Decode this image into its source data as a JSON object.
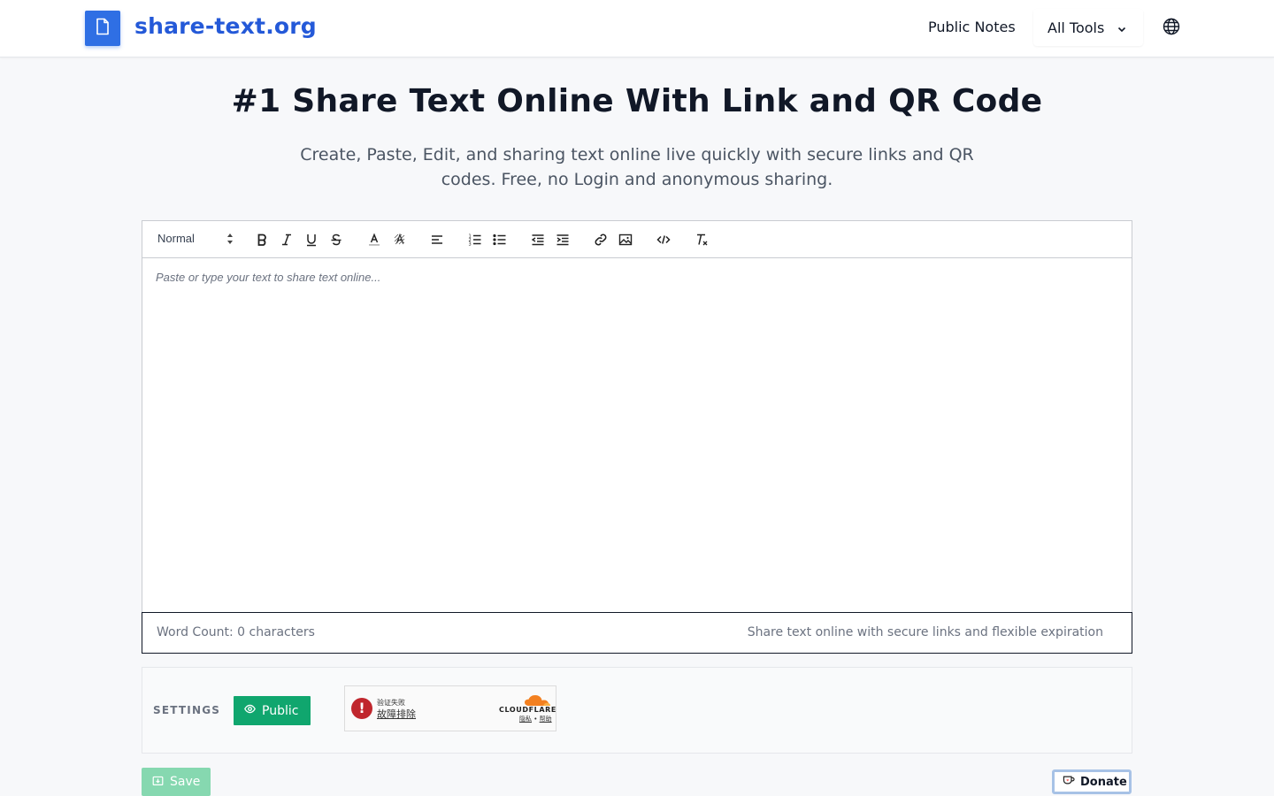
{
  "header": {
    "brand": "share-text.org",
    "nav_public_notes": "Public Notes",
    "nav_all_tools": "All Tools",
    "logo_icon": "document-icon",
    "language_icon": "globe-icon"
  },
  "hero": {
    "title": "#1 Share Text Online With Link and QR Code",
    "subtitle": "Create, Paste, Edit, and sharing text online live quickly with secure links and QR codes. Free, no Login and anonymous sharing."
  },
  "editor": {
    "format_selected": "Normal",
    "toolbar_icons": [
      "bold-icon",
      "italic-icon",
      "underline-icon",
      "strike-icon",
      "text-color-icon",
      "background-color-icon",
      "align-icon",
      "ordered-list-icon",
      "bullet-list-icon",
      "outdent-icon",
      "indent-icon",
      "link-icon",
      "image-icon",
      "code-icon",
      "clear-format-icon"
    ],
    "placeholder": "Paste or type your text to share text online...",
    "word_count": "Word Count: 0 characters",
    "footer_note": "Share text online with secure links and flexible expiration"
  },
  "settings": {
    "label": "SETTINGS",
    "visibility_button": "Public",
    "captcha": {
      "status_line": "验证失败",
      "troubleshoot_link": "故障排除",
      "provider": "CLOUDFLARE",
      "privacy_link": "隐私",
      "separator": "•",
      "help_link": "帮助"
    }
  },
  "actions": {
    "save_label": "Save",
    "donate_label": "Donate"
  },
  "colors": {
    "brand_blue": "#2459d8",
    "public_green": "#10a66e",
    "save_green_disabled": "#86d8b0",
    "alert_red": "#c0262d",
    "cloudflare_orange": "#f38020"
  }
}
